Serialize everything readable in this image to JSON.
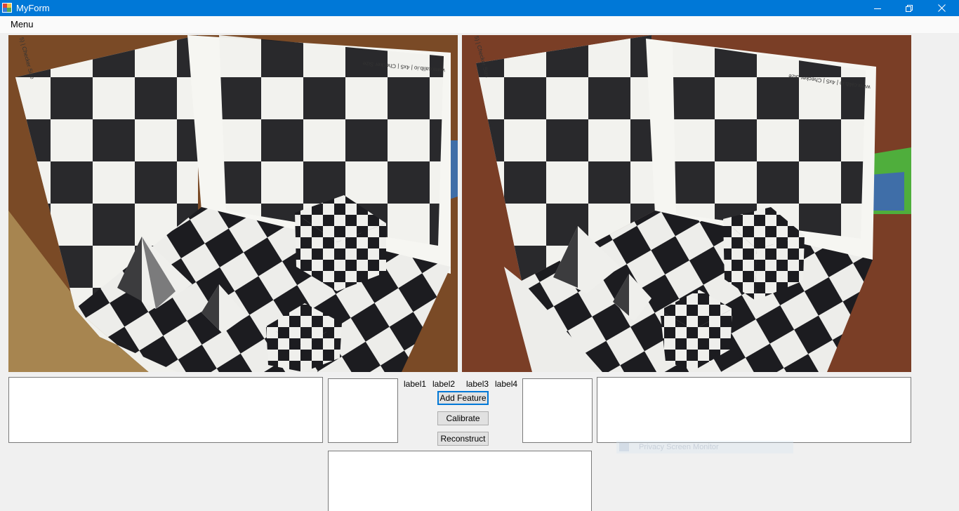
{
  "window": {
    "title": "MyForm"
  },
  "menu": {
    "items": [
      {
        "label": "Menu"
      }
    ]
  },
  "images": {
    "left": {
      "icon": "checkerboard-scene-photo"
    },
    "right": {
      "icon": "checkerboard-scene-photo"
    },
    "board_text": "www.calib.io | 4x5 | Checker Size",
    "board_side_text": "5) | Checker Size"
  },
  "labels": {
    "label1": "label1",
    "label2": "label2",
    "label3": "label3",
    "label4": "label4"
  },
  "buttons": {
    "add_feature": "Add Feature",
    "calibrate": "Calibrate",
    "reconstruct": "Reconstruct"
  },
  "textboxes": {
    "left_output": "",
    "left_small": "",
    "right_small": "",
    "right_output": "",
    "bottom_output": ""
  },
  "overlay": {
    "faint_text": "Privacy Screen Monitor"
  },
  "colors": {
    "titlebar": "#0078d7",
    "background": "#f0f0f0",
    "default_button_border": "#0078d7"
  }
}
